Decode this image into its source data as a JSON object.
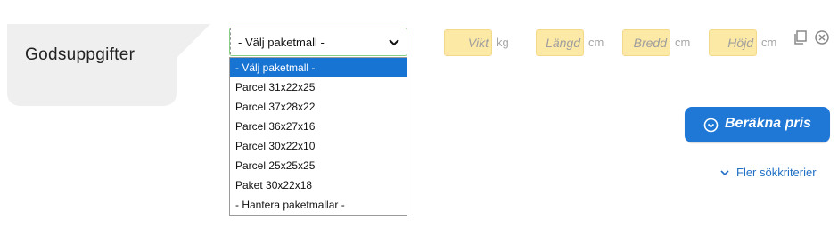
{
  "section": {
    "title": "Godsuppgifter"
  },
  "package_template": {
    "selected": "- Välj paketmall -",
    "options": [
      "- Välj paketmall -",
      "Parcel 31x22x25",
      "Parcel 37x28x22",
      "Parcel 36x27x16",
      "Parcel 30x22x10",
      "Parcel 25x25x25",
      "Paket 30x22x18",
      "- Hantera paketmallar -"
    ]
  },
  "dimensions": {
    "weight": {
      "placeholder": "Vikt",
      "unit": "kg"
    },
    "length": {
      "placeholder": "Längd",
      "unit": "cm"
    },
    "width": {
      "placeholder": "Bredd",
      "unit": "cm"
    },
    "height": {
      "placeholder": "Höjd",
      "unit": "cm"
    }
  },
  "actions": {
    "calculate_label": "Beräkna pris",
    "more_criteria_label": "Fler sökkriterier"
  },
  "icons": {
    "copy": "copy-icon",
    "remove": "close-circle-icon",
    "calculate": "chevron-circle-icon",
    "more": "chevron-down-icon"
  },
  "colors": {
    "accent": "#1f78d6",
    "selected_option": "#1874d2",
    "dimension_field": "#fde9a6",
    "tag_background": "#efefef"
  }
}
